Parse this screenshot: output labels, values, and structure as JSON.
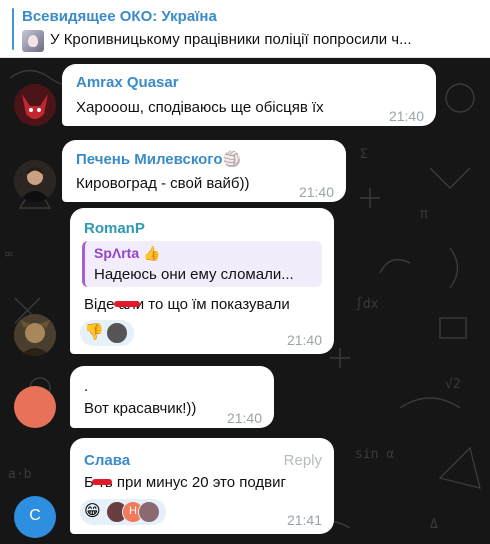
{
  "pinned": {
    "title": "Всевидящее ОКО: Україна",
    "text": "У Кропивницькому працівники поліції попросили ч..."
  },
  "messages": [
    {
      "author": "Amrax Quasar",
      "author_color": "#3a8bc8",
      "text": "Харооош, сподіваюсь ще обісцяв їх",
      "time": "21:40"
    },
    {
      "author": "Печень Милевского",
      "author_emoji": "🏐",
      "author_color": "#3a8bc8",
      "text": "Кировоград - свой вайб))",
      "time": "21:40"
    },
    {
      "author": "RomanP",
      "author_color": "#2e9ab3",
      "quote": {
        "author": "SpΛrta",
        "author_emoji": "👍",
        "text": "Надеюсь они ему сломали..."
      },
      "text": "Віде  али то що їм показували",
      "time": "21:40",
      "reactions": [
        {
          "icon": "thumbs-down-icon",
          "emoji": "👎"
        }
      ]
    },
    {
      "author": "",
      "line1": ".",
      "text": "Вот красавчик!))",
      "time": "21:40",
      "avatar_color": "#e8715a"
    },
    {
      "author": "Слава",
      "author_color": "#3a8bc8",
      "reply_label": "Reply",
      "text": "Б  ть при минус 20 это подвиг",
      "time": "21:41",
      "avatar_letter": "С",
      "avatar_color": "#2e8ee0",
      "reactions": [
        {
          "icon": "grinning-face-icon",
          "emoji": "😁"
        }
      ],
      "reaction_avatar_letter": "H"
    }
  ]
}
